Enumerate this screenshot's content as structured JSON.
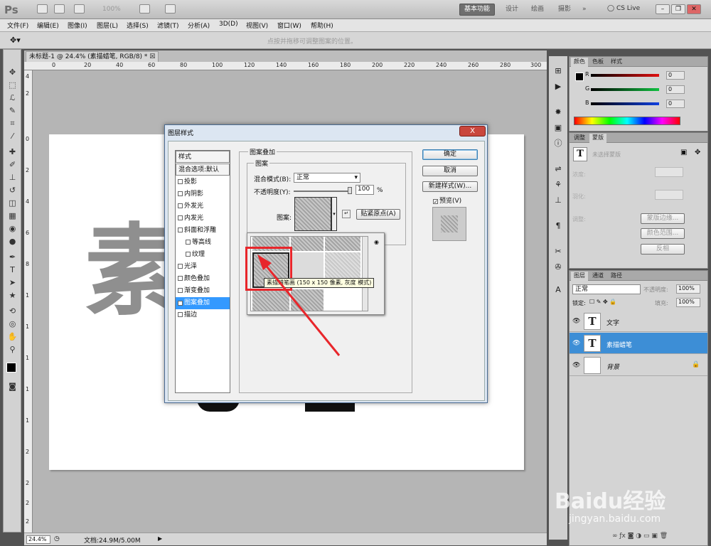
{
  "app": {
    "logo": "Ps",
    "zoom_display": "100%"
  },
  "workspaces": [
    "基本功能",
    "设计",
    "绘画",
    "摄影",
    "»"
  ],
  "cs_live": "CS Live",
  "menu": [
    "文件(F)",
    "编辑(E)",
    "图像(I)",
    "图层(L)",
    "选择(S)",
    "滤镜(T)",
    "分析(A)",
    "3D(D)",
    "视图(V)",
    "窗口(W)",
    "帮助(H)"
  ],
  "options_bar": {
    "hint": "点按并拖移可调整图案的位置。"
  },
  "document": {
    "tab_title": "未标题-1 @ 24.4% (素描蜡笔, RGB/8) *",
    "ruler_top": [
      "0",
      "20",
      "40",
      "60",
      "80",
      "100",
      "120",
      "140",
      "160",
      "180",
      "200",
      "220",
      "240",
      "260",
      "280",
      "300"
    ],
    "ruler_left": [
      "4",
      "2",
      "0",
      "2",
      "4",
      "6",
      "8",
      "1",
      "1",
      "1",
      "1",
      "1",
      "2",
      "2",
      "2",
      "2"
    ],
    "canvas_text": "素"
  },
  "status": {
    "zoom": "24.4%",
    "doc": "文档:24.9M/5.00M"
  },
  "color_panel": {
    "tabs": [
      "颜色",
      "色板",
      "样式"
    ],
    "channels": [
      {
        "label": "R",
        "value": "0",
        "color": "#c01010"
      },
      {
        "label": "G",
        "value": "0",
        "color": "#10a030"
      },
      {
        "label": "B",
        "value": "0",
        "color": "#1030c0"
      }
    ]
  },
  "adjust_panel": {
    "tabs": [
      "调整",
      "蒙版"
    ],
    "title": "未选择蒙版",
    "density_label": "浓度:",
    "feather_label": "羽化:",
    "refine_label": "调整:",
    "buttons": [
      "蒙版边缘...",
      "颜色范围...",
      "反相"
    ]
  },
  "layers_panel": {
    "tabs": [
      "图层",
      "通道",
      "路径"
    ],
    "blend_mode": "正常",
    "opacity_label": "不透明度:",
    "opacity": "100%",
    "lock_label": "锁定:",
    "fill_label": "填充:",
    "fill": "100%",
    "layers": [
      {
        "name": "文字",
        "thumb": "T",
        "selected": false
      },
      {
        "name": "素描蜡笔",
        "thumb": "T",
        "selected": true
      },
      {
        "name": "背景",
        "thumb": "",
        "selected": false
      }
    ]
  },
  "dialog": {
    "title": "图层样式",
    "close": "X",
    "styles_header": "样式",
    "blend_defaults": "混合选项:默认",
    "styles": [
      {
        "label": "投影",
        "checked": false
      },
      {
        "label": "内阴影",
        "checked": false
      },
      {
        "label": "外发光",
        "checked": false
      },
      {
        "label": "内发光",
        "checked": false
      },
      {
        "label": "斜面和浮雕",
        "checked": false
      },
      {
        "label": "等高线",
        "checked": false
      },
      {
        "label": "纹理",
        "checked": false
      },
      {
        "label": "光泽",
        "checked": false
      },
      {
        "label": "颜色叠加",
        "checked": false
      },
      {
        "label": "渐变叠加",
        "checked": false
      },
      {
        "label": "图案叠加",
        "checked": true
      },
      {
        "label": "描边",
        "checked": false
      }
    ],
    "section_title": "图案叠加",
    "subsection": "图案",
    "blend_mode_label": "混合模式(B):",
    "blend_mode": "正常",
    "opacity_label": "不透明度(Y):",
    "opacity": "100",
    "percent": "%",
    "pattern_label": "图案:",
    "snap_origin": "贴紧原点(A)",
    "ok": "确定",
    "cancel": "取消",
    "new_style": "新建样式(W)...",
    "preview": "预览(V)",
    "tooltip": "素描蜡笔画 (150 x 150 像素, 灰度 模式)"
  },
  "watermark": {
    "brand": "Baidu经验",
    "url": "jingyan.baidu.com"
  },
  "colors": {
    "accent": "#3399ff",
    "annotation": "#e8262b"
  }
}
